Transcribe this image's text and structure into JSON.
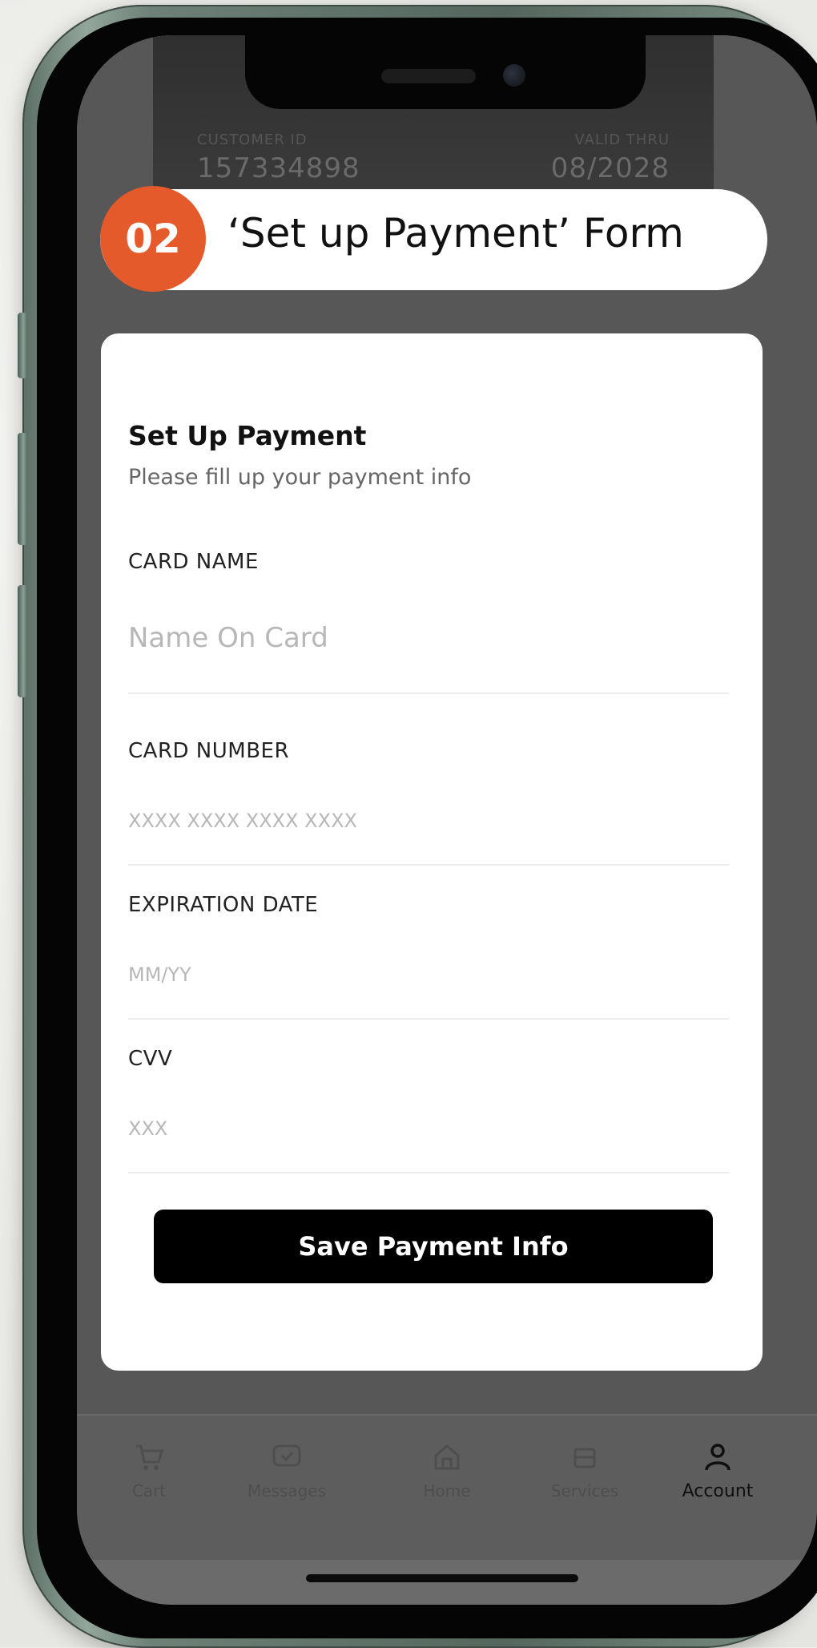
{
  "header": {
    "step_number": "02",
    "step_title": "‘Set up Payment’ Form"
  },
  "background_card": {
    "customer_id_label": "CUSTOMER ID",
    "customer_id": "157334898",
    "valid_thru_label": "VALID THRU",
    "valid_thru": "08/2028"
  },
  "form": {
    "title": "Set Up Payment",
    "subtitle": "Please fill up your payment info",
    "fields": [
      {
        "label": "CARD NAME",
        "placeholder": "Name On Card"
      },
      {
        "label": "CARD NUMBER",
        "placeholder": "XXXX XXXX XXXX XXXX"
      },
      {
        "label": "EXPIRATION DATE",
        "placeholder": "MM/YY"
      },
      {
        "label": "CVV",
        "placeholder": "XXX"
      }
    ],
    "save_button_label": "Save Payment Info"
  },
  "tab_bar": {
    "items": [
      {
        "label": "Cart",
        "icon": "cart-icon",
        "active": false
      },
      {
        "label": "Messages",
        "icon": "message-icon",
        "active": false
      },
      {
        "label": "Home",
        "icon": "home-icon",
        "active": false
      },
      {
        "label": "Services",
        "icon": "services-icon",
        "active": false
      },
      {
        "label": "Account",
        "icon": "user-icon",
        "active": true
      }
    ]
  },
  "colors": {
    "accent": "#e55a2b",
    "button": "#000000",
    "overlay": "#575757"
  }
}
